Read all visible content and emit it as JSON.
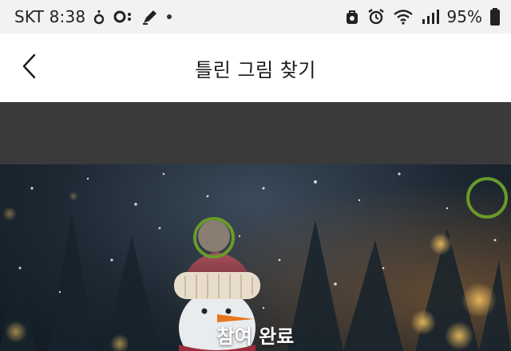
{
  "status_bar": {
    "carrier_time": "SKT 8:38",
    "battery": "95%",
    "icons": [
      "notification-icon",
      "loop-icon",
      "pen-icon",
      "dot-icon",
      "vpn-icon",
      "alarm-icon",
      "wifi-icon",
      "signal-icon",
      "battery-icon"
    ]
  },
  "header": {
    "title": "틀린 그림 찾기",
    "back_icon": "chevron-left-icon"
  },
  "game": {
    "completion_label": "참여 완료",
    "found_markers": 2,
    "marker_color": "#6a9a2a"
  },
  "colors": {
    "status_bar_bg": "#f2f2f2",
    "dark_band": "#3a3a3a",
    "header_bg": "#ffffff"
  }
}
